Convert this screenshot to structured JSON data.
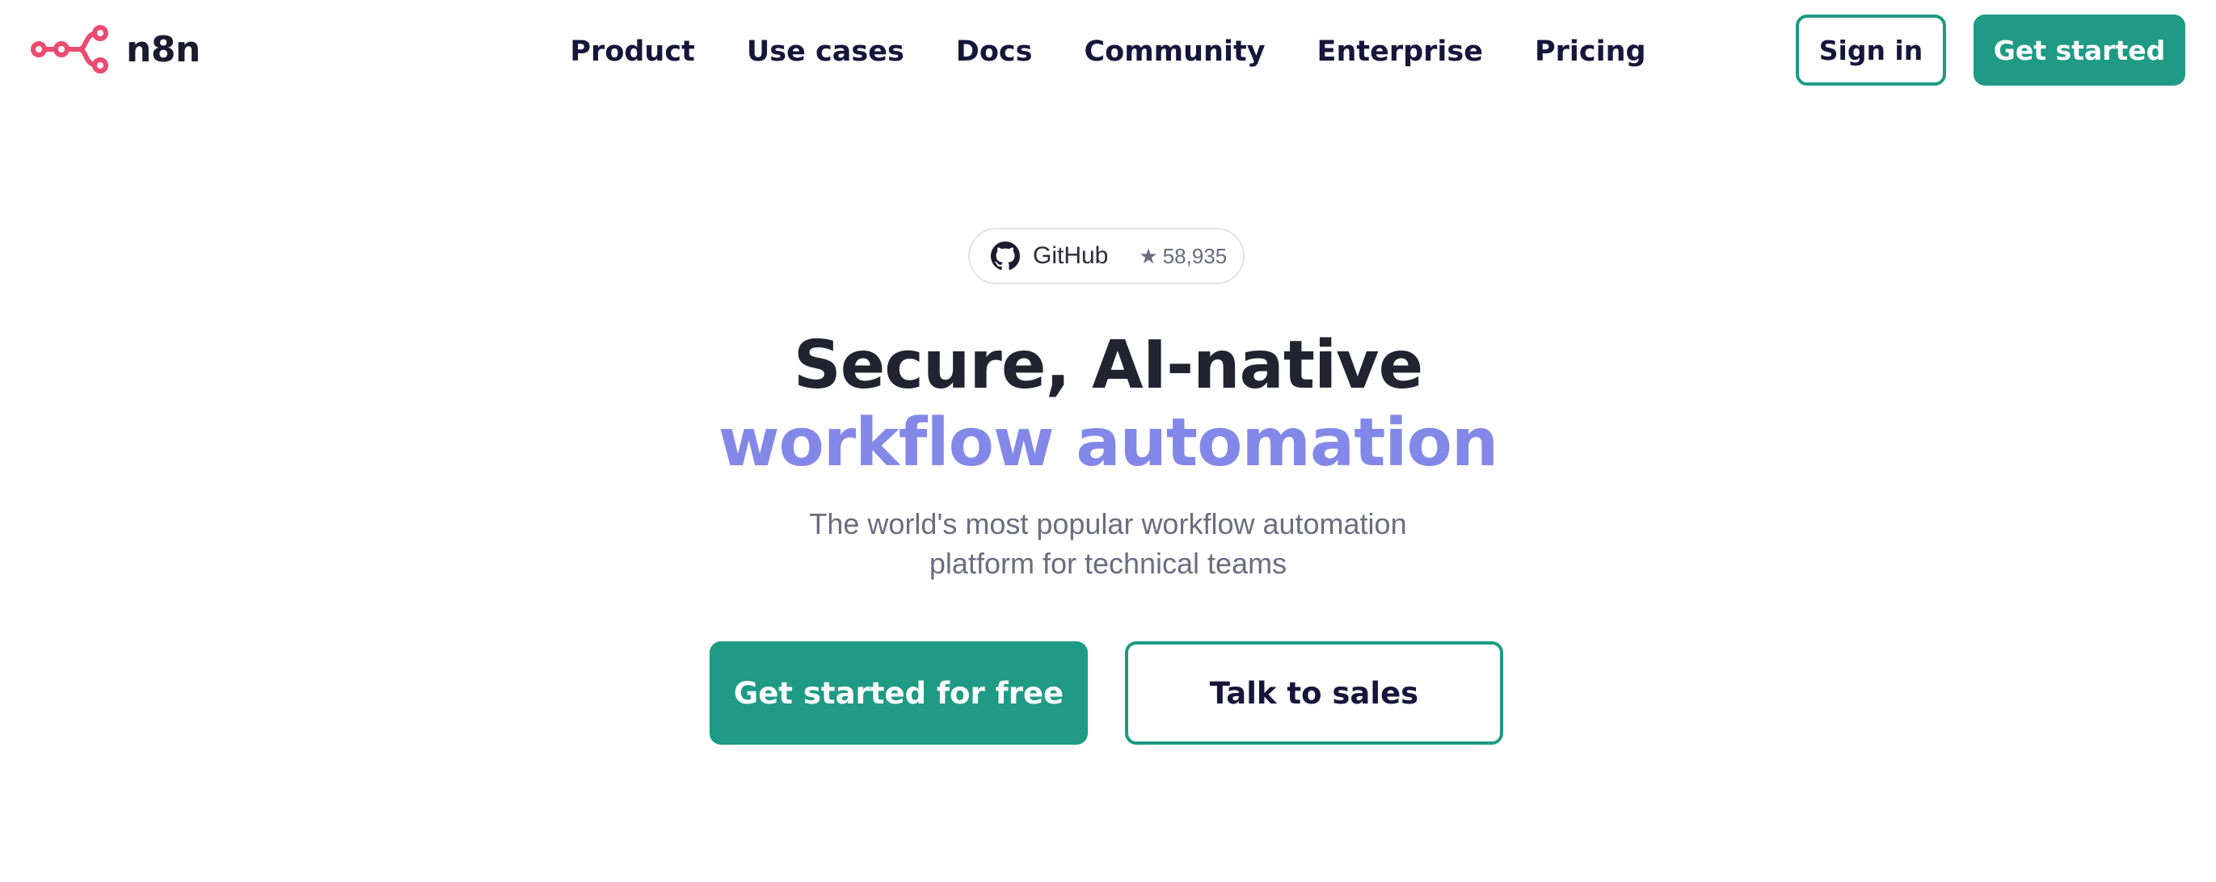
{
  "brand": {
    "name": "n8n",
    "logo_color": "#ea4b71"
  },
  "nav": {
    "items": [
      {
        "label": "Product"
      },
      {
        "label": "Use cases"
      },
      {
        "label": "Docs"
      },
      {
        "label": "Community"
      },
      {
        "label": "Enterprise"
      },
      {
        "label": "Pricing"
      }
    ]
  },
  "header_actions": {
    "sign_in_label": "Sign in",
    "get_started_label": "Get started"
  },
  "github_badge": {
    "label": "GitHub",
    "icon": "github-icon",
    "star_icon": "star-icon",
    "stars": "58,935"
  },
  "hero": {
    "title_line1": "Secure, AI-native",
    "title_line2": "workflow automation",
    "subtitle_line1": "The world's most popular workflow automation",
    "subtitle_line2": "platform for technical teams",
    "primary_cta": "Get started for free",
    "secondary_cta": "Talk to sales"
  },
  "colors": {
    "accent": "#1e9a85",
    "highlight": "#8388e8",
    "text": "#16163a",
    "muted": "#6c6c80"
  }
}
